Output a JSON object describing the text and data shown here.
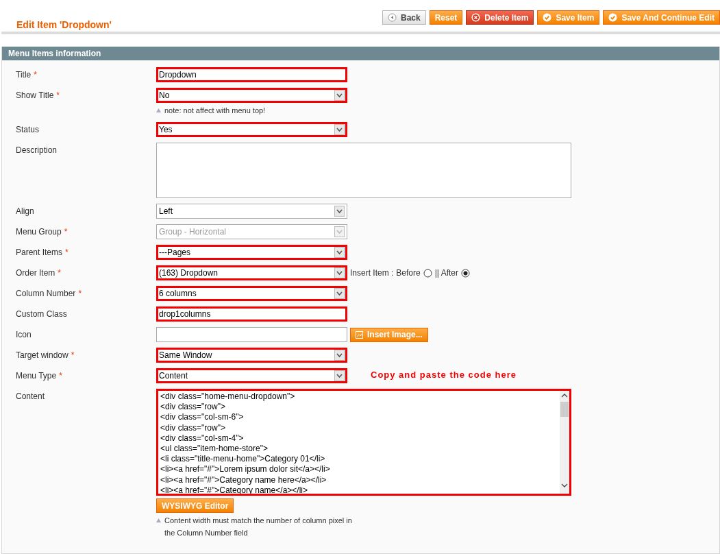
{
  "page_title": "Edit Item 'Dropdown'",
  "actions": [
    {
      "label": "Back",
      "kind": "back"
    },
    {
      "label": "Reset",
      "kind": "plain"
    },
    {
      "label": "Delete Item",
      "kind": "delete"
    },
    {
      "label": "Save Item",
      "kind": "save"
    },
    {
      "label": "Save And Continue Edit",
      "kind": "save"
    }
  ],
  "section_title": "Menu Items information",
  "fields": [
    {
      "label": "Title",
      "required_mark": "*",
      "kind": "text",
      "value": "Dropdown",
      "highlighted": true
    },
    {
      "label": "Show Title",
      "required_mark": "*",
      "kind": "select",
      "value": "No",
      "highlighted": true,
      "note": "note: not affect with menu top!"
    },
    {
      "label": "Status",
      "kind": "select",
      "value": "Yes",
      "highlighted": true
    },
    {
      "label": "Description",
      "kind": "textarea",
      "highlighted": false
    },
    {
      "label": "Align",
      "kind": "select",
      "value": "Left",
      "highlighted": false
    },
    {
      "label": "Menu Group",
      "required_mark": "*",
      "kind": "select",
      "value": "Group - Horizontal",
      "highlighted": false,
      "disabled": true
    },
    {
      "label": "Parent Items",
      "required_mark": "*",
      "kind": "select",
      "value": "---Pages",
      "highlighted": true
    },
    {
      "label": "Order Item",
      "required_mark": "*",
      "kind": "select",
      "value": "(163) Dropdown",
      "highlighted": true,
      "insert": {
        "prefix": "Insert Item :",
        "options": [
          {
            "label": "Before",
            "selected": false
          },
          {
            "label": "|| After",
            "selected": true
          }
        ]
      }
    },
    {
      "label": "Column Number",
      "required_mark": "*",
      "kind": "select",
      "value": "6 columns",
      "highlighted": true
    },
    {
      "label": "Custom Class",
      "kind": "text",
      "value": "drop1columns",
      "highlighted": true
    },
    {
      "label": "Icon",
      "kind": "image",
      "button": "Insert Image...",
      "highlighted": false
    },
    {
      "label": "Target window",
      "required_mark": "*",
      "kind": "select",
      "value": "Same Window",
      "highlighted": true
    },
    {
      "label": "Menu Type",
      "required_mark": "*",
      "kind": "select",
      "value": "Content",
      "highlighted": true,
      "annotation": "Copy and paste the code here"
    },
    {
      "label": "Content",
      "kind": "code",
      "highlighted": true,
      "lines": [
        "<div class=\"home-menu-dropdown\">",
        "<div class=\"row\">",
        "<div class=\"col-sm-6\">",
        "<div class=\"row\">",
        "<div class=\"col-sm-4\">",
        "<ul class=\"item-home-store\">",
        "<li class=\"title-menu-home\">Category 01</li>",
        "<li><a href=\"#\">Lorem ipsum dolor sit</a></li>",
        "<li><a href=\"#\">Category name here</a></li>",
        "<li><a href=\"#\">Category name</a></li>"
      ],
      "button": "WYSIWYG Editor",
      "note_lines": [
        "Content width must match the number of column pixel in",
        "the Column Number field"
      ]
    }
  ]
}
